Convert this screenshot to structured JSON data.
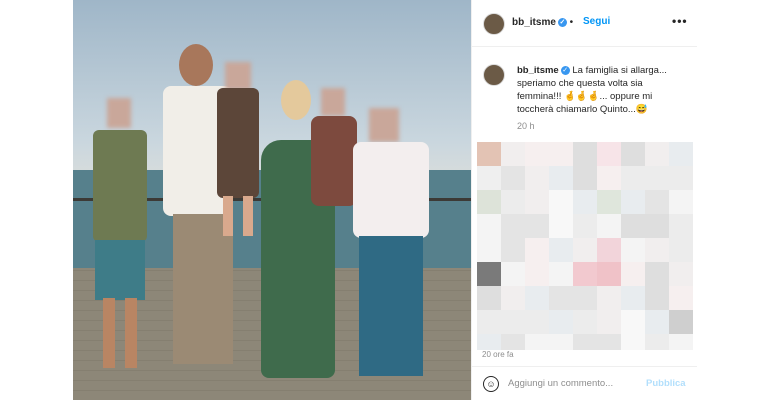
{
  "post": {
    "username": "bb_itsme",
    "follow_label": "Segui",
    "more_label": "•••",
    "caption_user": "bb_itsme",
    "caption_lines": [
      "La famiglia si allarga...",
      "speriamo che questa volta sia",
      "femmina!!! 🤞🤞🤞... oppure mi",
      "toccherà chiamarlo Quinto...😅"
    ],
    "time_ago": "20 h",
    "faded_time": "20 ore fa",
    "comment_placeholder": "Aggiungi un commento...",
    "publish_label": "Pubblica",
    "icons": {
      "verified": "verified-badge-icon",
      "emoji": "emoji-icon",
      "more": "more-options-icon"
    },
    "colors": {
      "accent": "#0095f6",
      "verified": "#3897f0",
      "publish_disabled": "#b2dffc"
    }
  }
}
